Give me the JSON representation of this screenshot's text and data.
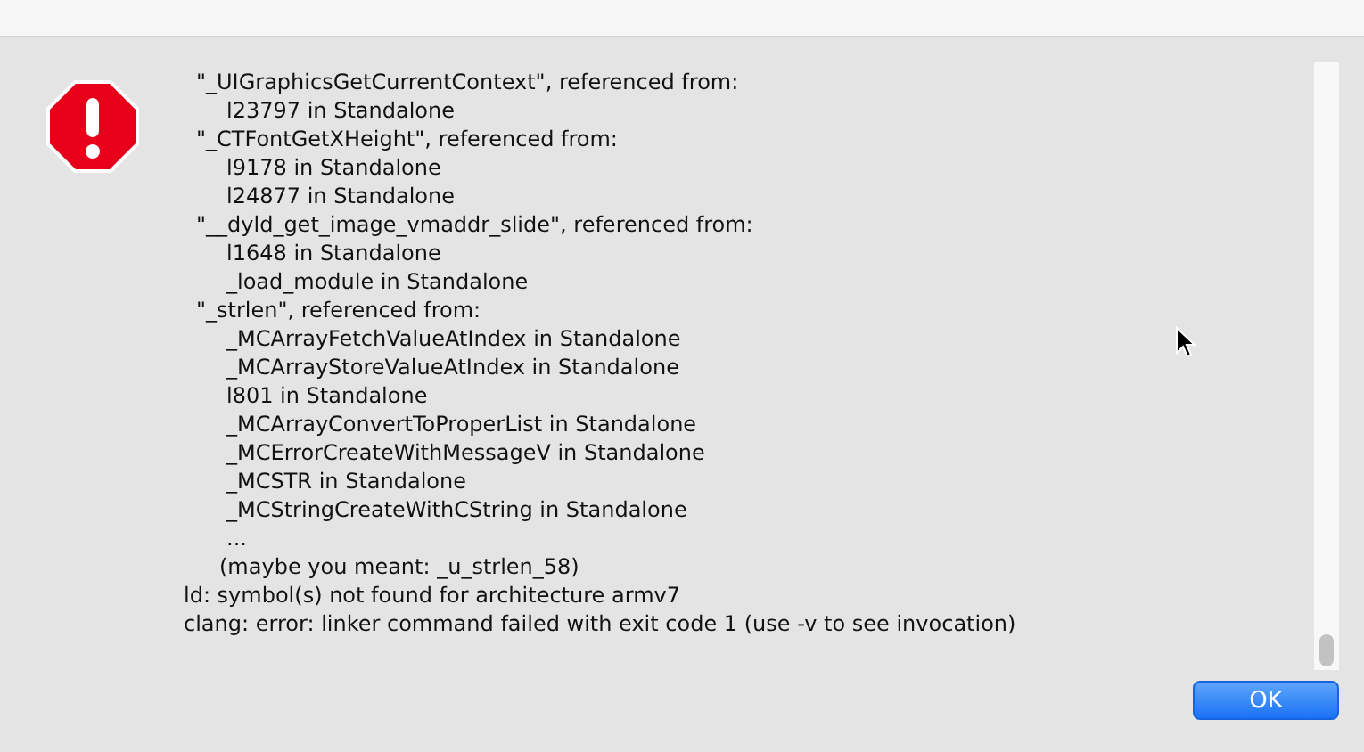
{
  "alert": {
    "lines": [
      {
        "kind": "symbol",
        "text": "\"_UIGraphicsGetCurrentContext\", referenced from:"
      },
      {
        "kind": "reference",
        "text": "l23797 in Standalone"
      },
      {
        "kind": "symbol",
        "text": "\"_CTFontGetXHeight\", referenced from:"
      },
      {
        "kind": "reference",
        "text": "l9178 in Standalone"
      },
      {
        "kind": "reference",
        "text": "l24877 in Standalone"
      },
      {
        "kind": "symbol",
        "text": "\"__dyld_get_image_vmaddr_slide\", referenced from:"
      },
      {
        "kind": "reference",
        "text": "l1648 in Standalone"
      },
      {
        "kind": "reference",
        "text": "_load_module in Standalone"
      },
      {
        "kind": "symbol",
        "text": "\"_strlen\", referenced from:"
      },
      {
        "kind": "reference",
        "text": "_MCArrayFetchValueAtIndex in Standalone"
      },
      {
        "kind": "reference",
        "text": "_MCArrayStoreValueAtIndex in Standalone"
      },
      {
        "kind": "reference",
        "text": "l801 in Standalone"
      },
      {
        "kind": "reference",
        "text": "_MCArrayConvertToProperList in Standalone"
      },
      {
        "kind": "reference",
        "text": "_MCErrorCreateWithMessageV in Standalone"
      },
      {
        "kind": "reference",
        "text": "_MCSTR in Standalone"
      },
      {
        "kind": "reference",
        "text": "_MCStringCreateWithCString in Standalone"
      },
      {
        "kind": "reference",
        "text": "..."
      },
      {
        "kind": "hint",
        "text": "(maybe you meant: _u_strlen_58)"
      },
      {
        "kind": "summary",
        "text": "ld: symbol(s) not found for architecture armv7"
      },
      {
        "kind": "summary",
        "text": "clang: error: linker command failed with exit code 1 (use -v to see invocation)"
      }
    ],
    "buttons": [
      {
        "label": "OK",
        "default": true
      }
    ]
  }
}
